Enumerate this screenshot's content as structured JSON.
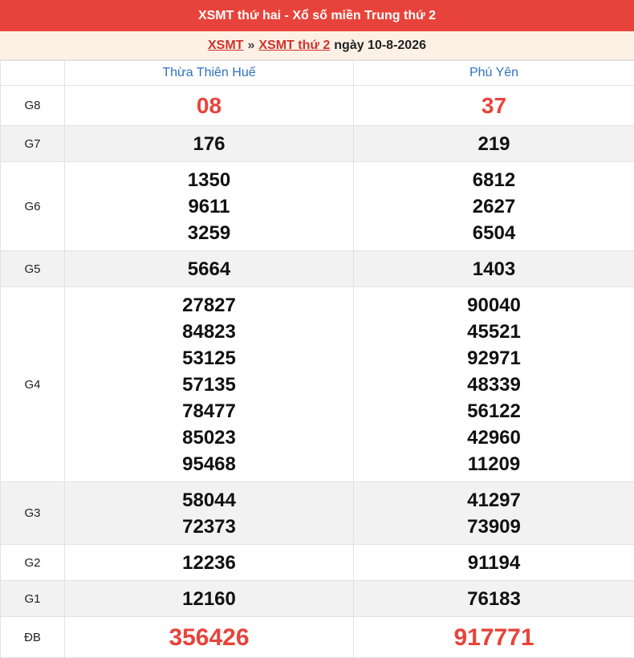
{
  "header": {
    "title": "XSMT thứ hai - Xổ số miền Trung thứ 2"
  },
  "breadcrumb": {
    "link1": "XSMT",
    "separator": "»",
    "link2": "XSMT thứ 2",
    "date_text": "ngày 10-8-2026"
  },
  "provinces": [
    "Thừa Thiên Huế",
    "Phú Yên"
  ],
  "prizes": [
    {
      "label": "G8",
      "col1": [
        "08"
      ],
      "col2": [
        "37"
      ]
    },
    {
      "label": "G7",
      "col1": [
        "176"
      ],
      "col2": [
        "219"
      ]
    },
    {
      "label": "G6",
      "col1": [
        "1350",
        "9611",
        "3259"
      ],
      "col2": [
        "6812",
        "2627",
        "6504"
      ]
    },
    {
      "label": "G5",
      "col1": [
        "5664"
      ],
      "col2": [
        "1403"
      ]
    },
    {
      "label": "G4",
      "col1": [
        "27827",
        "84823",
        "53125",
        "57135",
        "78477",
        "85023",
        "95468"
      ],
      "col2": [
        "90040",
        "45521",
        "92971",
        "48339",
        "56122",
        "42960",
        "11209"
      ]
    },
    {
      "label": "G3",
      "col1": [
        "58044",
        "72373"
      ],
      "col2": [
        "41297",
        "73909"
      ]
    },
    {
      "label": "G2",
      "col1": [
        "12236"
      ],
      "col2": [
        "91194"
      ]
    },
    {
      "label": "G1",
      "col1": [
        "12160"
      ],
      "col2": [
        "76183"
      ]
    },
    {
      "label": "ĐB",
      "col1": [
        "356426"
      ],
      "col2": [
        "917771"
      ]
    }
  ],
  "colors": {
    "header_bg": "#e8433a",
    "subheader_bg": "#fdf1e6",
    "link": "#2f72c0",
    "highlight": "#e8433a"
  }
}
